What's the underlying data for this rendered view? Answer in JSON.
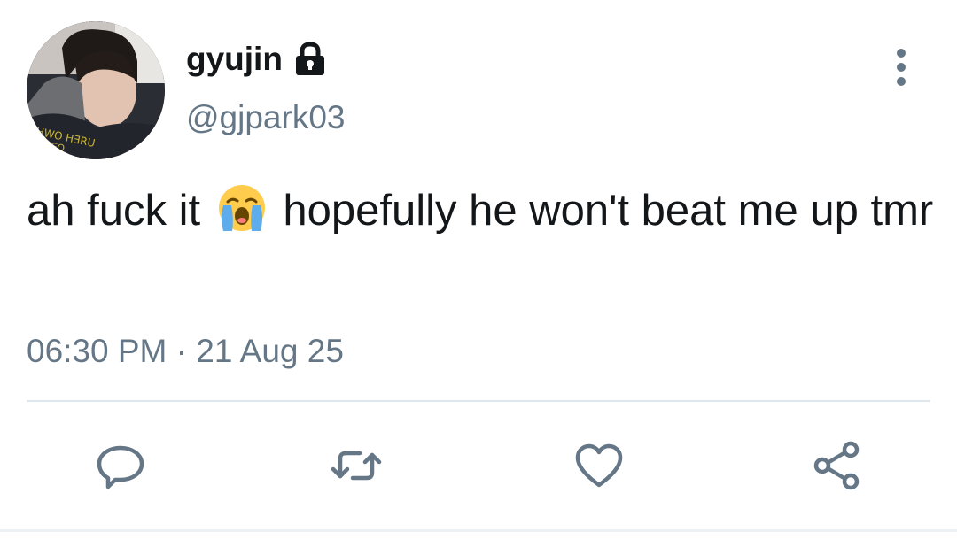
{
  "tweet": {
    "display_name": "gyujin",
    "handle": "@gjpark03",
    "text_before_emoji": "ah fuck it ",
    "text_after_emoji": " hopefully he won't beat me up tmr",
    "timestamp": "06:30 PM · 21 Aug 25",
    "emoji": "loudly-crying-face",
    "protected_badge_icon": "lock-icon"
  },
  "actions": {
    "reply_icon": "reply-icon",
    "retweet_icon": "retweet-icon",
    "like_icon": "like-icon",
    "share_icon": "share-icon",
    "more_icon": "more-options-icon"
  },
  "colors": {
    "text_primary": "#14171a",
    "text_secondary": "#657786",
    "divider": "#e1e8ed"
  }
}
